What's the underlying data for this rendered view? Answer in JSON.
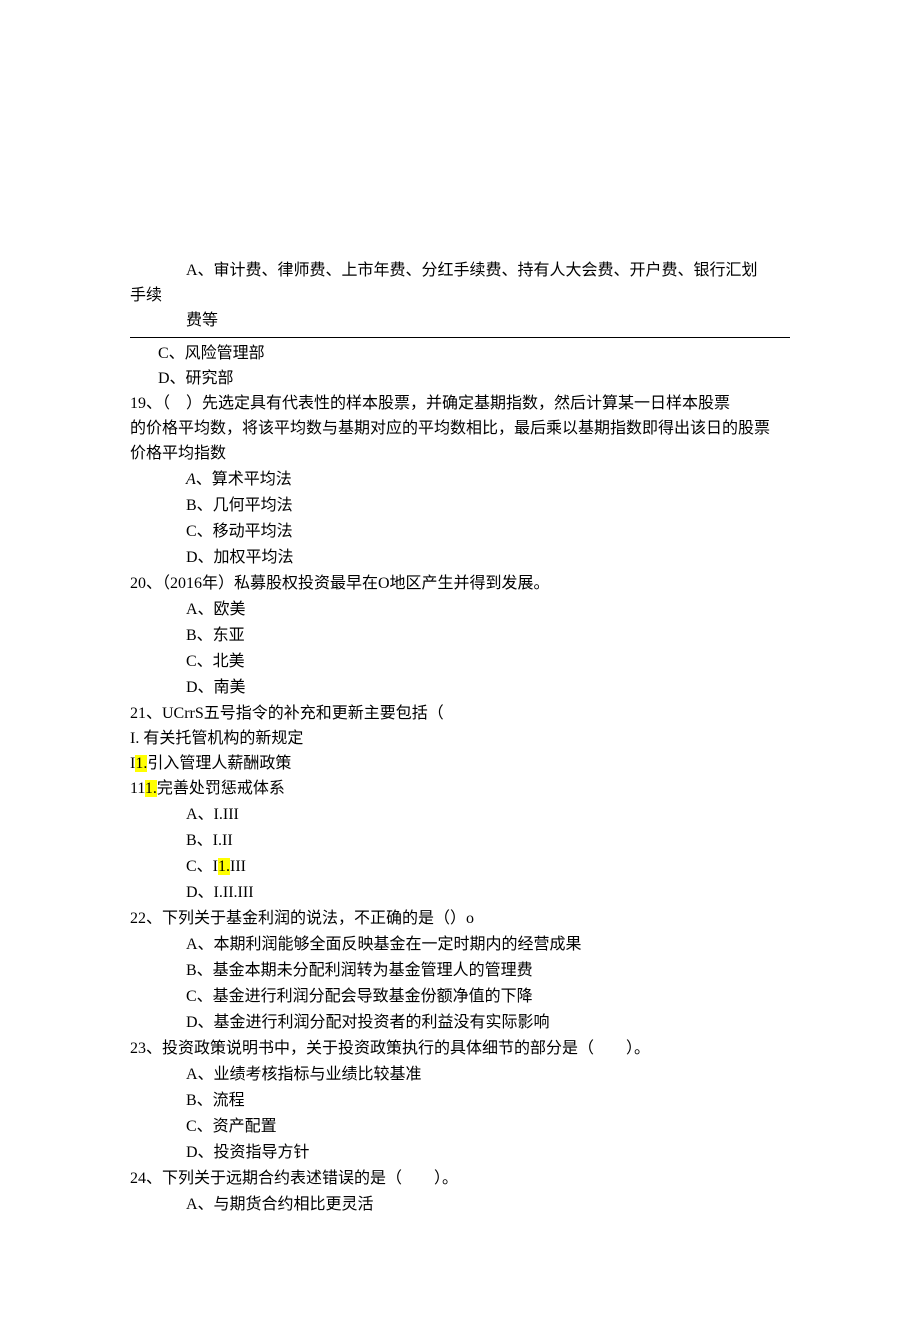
{
  "pre_hr": {
    "optA_line1": "A、审计费、律师费、上市年费、分红手续费、持有人大会费、开户费、银行汇划",
    "hand_cont": "手续",
    "optA_line2": "费等"
  },
  "post_hr_opts": {
    "C": "C、风险管理部",
    "D": "D、研究部"
  },
  "q19": {
    "stem1": "19、（　）先选定具有代表性的样本股票，并确定基期指数，然后计算某一日样本股票",
    "stem2": "的价格平均数，将该平均数与基期对应的平均数相比，最后乘以基期指数即得出该日的股票",
    "stem3": "价格平均指数",
    "A_prefix": "A",
    "A_text": "、算术平均法",
    "B": "B、几何平均法",
    "C": "C、移动平均法",
    "D": "D、加权平均法"
  },
  "q20": {
    "stem": "20、（2016年）私募股权投资最早在O地区产生并得到发展。",
    "A": "A、欧美",
    "B": "B、东亚",
    "C": "C、北美",
    "D": "D、南美"
  },
  "q21": {
    "stem": "21、UCrrS五号指令的补充和更新主要包括（",
    "sub1": "I. 有关托管机构的新规定",
    "sub2_pre": "I",
    "sub2_hl": "1.",
    "sub2_post": "引入管理人薪酬政策",
    "sub3_pre": "11",
    "sub3_hl": "1.",
    "sub3_post": "完善处罚惩戒体系",
    "A": "A、I.III",
    "B": "B、I.II",
    "C_pre": "C、I",
    "C_hl": "1.",
    "C_post": "III",
    "D": "D、I.II.III"
  },
  "q22": {
    "stem": "22、下列关于基金利润的说法，不正确的是（）o",
    "A": "A、本期利润能够全面反映基金在一定时期内的经营成果",
    "B": "B、基金本期未分配利润转为基金管理人的管理费",
    "C": "C、基金进行利润分配会导致基金份额净值的下降",
    "D": "D、基金进行利润分配对投资者的利益没有实际影响"
  },
  "q23": {
    "stem": "23、投资政策说明书中，关于投资政策执行的具体细节的部分是（　　）。",
    "A": "A、业绩考核指标与业绩比较基准",
    "B": "B、流程",
    "C": "C、资产配置",
    "D": "D、投资指导方针"
  },
  "q24": {
    "stem": "24、下列关于远期合约表述错误的是（　　）。",
    "A": "A、与期货合约相比更灵活"
  }
}
